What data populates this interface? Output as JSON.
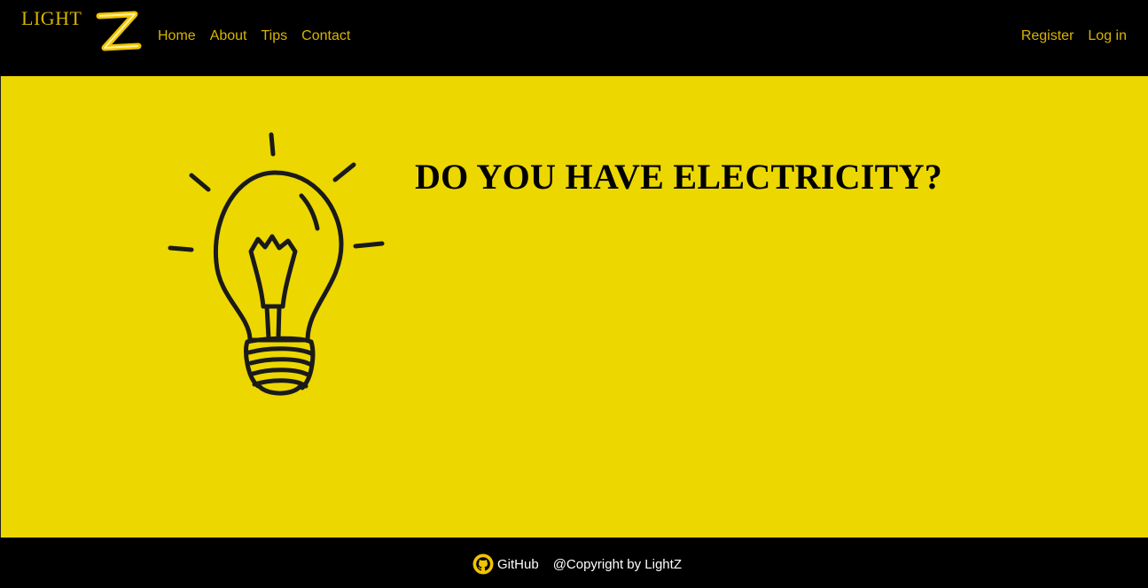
{
  "brand": {
    "word": "LIGHT",
    "letter": "Z"
  },
  "nav": {
    "left": [
      "Home",
      "About",
      "Tips",
      "Contact"
    ],
    "right": [
      "Register",
      "Log in"
    ]
  },
  "hero": {
    "title": "DO YOU HAVE ELECTRICITY?"
  },
  "footer": {
    "github": "GitHub",
    "copyright": "@Copyright by LightZ"
  },
  "colors": {
    "accent": "#d8b400",
    "hero_bg": "#ecd700",
    "bar_bg": "#000000"
  },
  "icons": {
    "brand_z": "lightning-z-icon",
    "bulb": "lightbulb-icon",
    "github": "github-icon"
  }
}
